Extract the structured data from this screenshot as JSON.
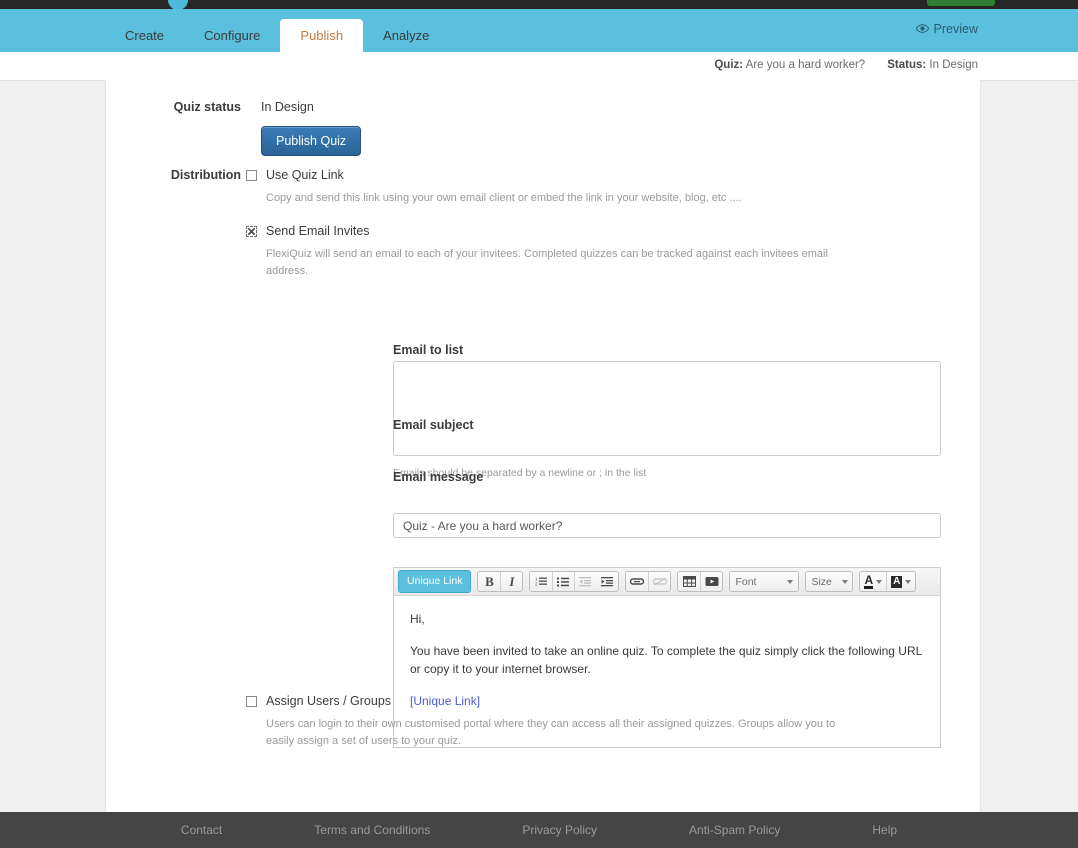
{
  "topbar": {
    "logo_icon": "circle-logo-icon",
    "account_button_icon": "account-button"
  },
  "nav": {
    "tabs": [
      {
        "label": "Create",
        "active": false
      },
      {
        "label": "Configure",
        "active": false
      },
      {
        "label": "Publish",
        "active": true
      },
      {
        "label": "Analyze",
        "active": false
      }
    ],
    "preview_label": "Preview",
    "preview_icon": "eye-icon"
  },
  "infostrip": {
    "quiz_key": "Quiz:",
    "quiz_name": "Are you a hard worker?",
    "status_key": "Status:",
    "status_value": "In Design"
  },
  "form": {
    "quiz_status_label": "Quiz status",
    "quiz_status_value": "In Design",
    "publish_button": "Publish Quiz",
    "distribution_label": "Distribution"
  },
  "options": {
    "use_quiz_link": {
      "title": "Use Quiz Link",
      "description": "Copy and send this link using your own email client or embed the link in your website, blog, etc ....",
      "checked": false
    },
    "send_email_invites": {
      "title": "Send Email Invites",
      "description": "FlexiQuiz will send an email to each of your invitees. Completed quizzes can be tracked against each invitees email address.",
      "checked": true
    },
    "assign_users_groups": {
      "title": "Assign Users / Groups",
      "description": "Users can login to their own customised portal where they can access all their assigned quizzes. Groups allow you to easily assign a set of users to your quiz.",
      "checked": false
    }
  },
  "email": {
    "list_label": "Email to list",
    "list_value": "",
    "list_placeholder": "",
    "list_hint": "Emails should be separated by a newline or ; in the list",
    "subject_label": "Email subject",
    "subject_value": "Quiz - Are you a hard worker?",
    "message_label": "Email message",
    "body": {
      "greeting": "Hi,",
      "paragraph": "You have been invited to take an online quiz. To complete the quiz simply click the following URL or copy it to your internet browser.",
      "link_text": "[Unique Link]"
    }
  },
  "toolbar": {
    "unique_link": "Unique Link",
    "bold": "B",
    "italic": "I",
    "ordered_list": "1≡",
    "unordered_list": "•≡",
    "outdent": "⇤",
    "indent": "⇥",
    "link": "🔗",
    "unlink": "⛓",
    "table": "▦",
    "youtube": "▶",
    "font_label": "Font",
    "size_label": "Size",
    "text_color": "A",
    "background_color": "A"
  },
  "footer": {
    "links": [
      "Contact",
      "Terms and Conditions",
      "Privacy Policy",
      "Anti-Spam Policy",
      "Help"
    ]
  },
  "colors": {
    "accent": "#5bc0de",
    "primary_button": "#2b6498",
    "footer_bg": "#454545",
    "topbar_bg": "#262626",
    "link": "#4a5bd4"
  }
}
